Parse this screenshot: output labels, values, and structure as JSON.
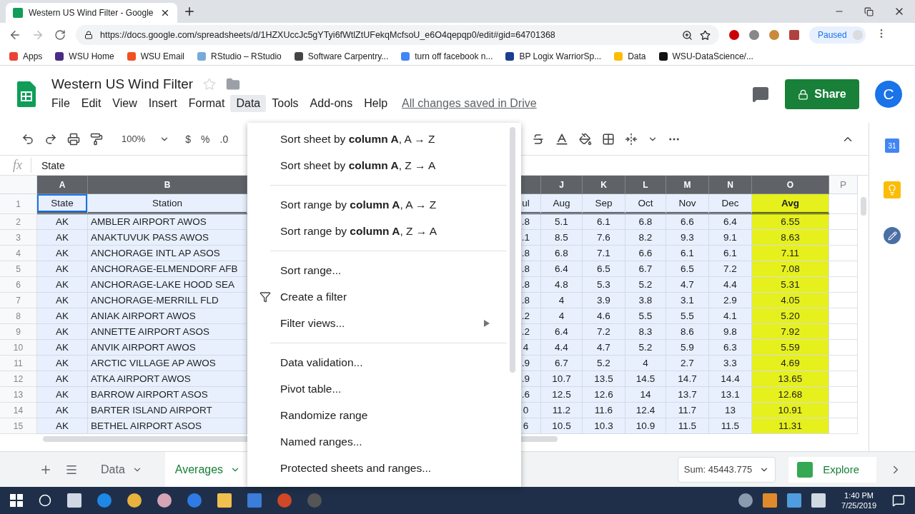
{
  "browser": {
    "tab_title": "Western US Wind Filter - Google",
    "url": "https://docs.google.com/spreadsheets/d/1HZXUccJc5gYTyi6fWtlZtUFekqMcfsoU_e6O4qepqp0/edit#gid=64701368",
    "profile_status": "Paused",
    "bookmarks": [
      {
        "label": "Apps",
        "color": "#ea4335"
      },
      {
        "label": "WSU Home",
        "color": "#4b2c83"
      },
      {
        "label": "WSU Email",
        "color": "#f25022"
      },
      {
        "label": "RStudio – RStudio",
        "color": "#75aadb"
      },
      {
        "label": "Software Carpentry...",
        "color": "#444444"
      },
      {
        "label": "turn off facebook n...",
        "color": "#4285f4"
      },
      {
        "label": "BP Logix WarriorSp...",
        "color": "#1a3d8f"
      },
      {
        "label": "Data",
        "color": "#fbbc04"
      },
      {
        "label": "WSU-DataScience/...",
        "color": "#111111"
      }
    ]
  },
  "doc": {
    "title": "Western US Wind Filter",
    "menus": [
      {
        "label": "File",
        "selected": false
      },
      {
        "label": "Edit",
        "selected": false
      },
      {
        "label": "View",
        "selected": false
      },
      {
        "label": "Insert",
        "selected": false
      },
      {
        "label": "Format",
        "selected": false
      },
      {
        "label": "Data",
        "selected": true
      },
      {
        "label": "Tools",
        "selected": false
      },
      {
        "label": "Add-ons",
        "selected": false
      },
      {
        "label": "Help",
        "selected": false
      }
    ],
    "save_status": "All changes saved in Drive",
    "share_label": "Share",
    "avatar_letter": "C"
  },
  "toolbar": {
    "zoom": "100%",
    "format_buttons": [
      "$",
      "%",
      ".0"
    ]
  },
  "formula_bar": {
    "fx_label": "fx",
    "value": "State"
  },
  "grid": {
    "header_row_number": "1",
    "columns": [
      {
        "letter": "A",
        "header": "State",
        "bold": false,
        "selected": true,
        "color": "#e8f0fe"
      },
      {
        "letter": "B",
        "header": "Station",
        "bold": false,
        "selected": false,
        "color": "#e8f0fe"
      },
      {
        "header": "ul",
        "bold": false,
        "selected": false,
        "color": "#e8f0fe"
      },
      {
        "letter": "J",
        "header": "Aug",
        "bold": false,
        "selected": false,
        "color": "#e8f0fe"
      },
      {
        "letter": "K",
        "header": "Sep",
        "bold": false,
        "selected": false,
        "color": "#e8f0fe"
      },
      {
        "letter": "L",
        "header": "Oct",
        "bold": false,
        "selected": false,
        "color": "#e8f0fe"
      },
      {
        "letter": "M",
        "header": "Nov",
        "bold": false,
        "selected": false,
        "color": "#e8f0fe"
      },
      {
        "letter": "N",
        "header": "Dec",
        "bold": false,
        "selected": false,
        "color": "#e8f0fe"
      },
      {
        "letter": "O",
        "header": "Avg",
        "bold": true,
        "selected": false,
        "color": "#e6f01c"
      }
    ],
    "extra_column": "P",
    "rows": [
      {
        "number": "2",
        "cells": [
          "AK",
          "AMBLER AIRPORT AWOS",
          ".8",
          "5.1",
          "6.1",
          "6.8",
          "6.6",
          "6.4",
          "6.55"
        ]
      },
      {
        "number": "3",
        "cells": [
          "AK",
          "ANAKTUVUK PASS AWOS",
          ".1",
          "8.5",
          "7.6",
          "8.2",
          "9.3",
          "9.1",
          "8.63"
        ]
      },
      {
        "number": "4",
        "cells": [
          "AK",
          "ANCHORAGE INTL AP ASOS",
          ".8",
          "6.8",
          "7.1",
          "6.6",
          "6.1",
          "6.1",
          "7.11"
        ]
      },
      {
        "number": "5",
        "cells": [
          "AK",
          "ANCHORAGE-ELMENDORF AFB",
          ".8",
          "6.4",
          "6.5",
          "6.7",
          "6.5",
          "7.2",
          "7.08"
        ]
      },
      {
        "number": "6",
        "cells": [
          "AK",
          "ANCHORAGE-LAKE HOOD SEA",
          ".8",
          "4.8",
          "5.3",
          "5.2",
          "4.7",
          "4.4",
          "5.31"
        ]
      },
      {
        "number": "7",
        "cells": [
          "AK",
          "ANCHORAGE-MERRILL FLD",
          ".8",
          "4",
          "3.9",
          "3.8",
          "3.1",
          "2.9",
          "4.05"
        ]
      },
      {
        "number": "8",
        "cells": [
          "AK",
          "ANIAK AIRPORT AWOS",
          ".2",
          "4",
          "4.6",
          "5.5",
          "5.5",
          "4.1",
          "5.20"
        ]
      },
      {
        "number": "9",
        "cells": [
          "AK",
          "ANNETTE AIRPORT ASOS",
          ".2",
          "6.4",
          "7.2",
          "8.3",
          "8.6",
          "9.8",
          "7.92"
        ]
      },
      {
        "number": "10",
        "cells": [
          "AK",
          "ANVIK AIRPORT AWOS",
          "4",
          "4.4",
          "4.7",
          "5.2",
          "5.9",
          "6.3",
          "5.59"
        ]
      },
      {
        "number": "11",
        "cells": [
          "AK",
          "ARCTIC VILLAGE AP AWOS",
          ".9",
          "6.7",
          "5.2",
          "4",
          "2.7",
          "3.3",
          "4.69"
        ]
      },
      {
        "number": "12",
        "cells": [
          "AK",
          "ATKA AIRPORT AWOS",
          ".9",
          "10.7",
          "13.5",
          "14.5",
          "14.7",
          "14.4",
          "13.65"
        ]
      },
      {
        "number": "13",
        "cells": [
          "AK",
          "BARROW AIRPORT ASOS",
          ".6",
          "12.5",
          "12.6",
          "14",
          "13.7",
          "13.1",
          "12.68"
        ]
      },
      {
        "number": "14",
        "cells": [
          "AK",
          "BARTER ISLAND AIRPORT",
          "0",
          "11.2",
          "11.6",
          "12.4",
          "11.7",
          "13",
          "10.91"
        ]
      },
      {
        "number": "15",
        "cells": [
          "AK",
          "BETHEL AIRPORT ASOS",
          "6",
          "10.5",
          "10.3",
          "10.9",
          "11.5",
          "11.5",
          "11.31"
        ]
      }
    ]
  },
  "side_panel": {
    "calendar_label": "31"
  },
  "data_menu": {
    "items": [
      {
        "kind": "item",
        "label": "Sort sheet by **column A**, A → Z"
      },
      {
        "kind": "item",
        "label": "Sort sheet by **column A**, Z → A"
      },
      {
        "kind": "separator"
      },
      {
        "kind": "item",
        "label": "Sort range by **column A**, A → Z"
      },
      {
        "kind": "item",
        "label": "Sort range by **column A**, Z → A"
      },
      {
        "kind": "separator"
      },
      {
        "kind": "item",
        "label": "Sort range..."
      },
      {
        "kind": "filter",
        "label": "Create a filter"
      },
      {
        "kind": "submenu",
        "label": "Filter views..."
      },
      {
        "kind": "separator"
      },
      {
        "kind": "item",
        "label": "Data validation..."
      },
      {
        "kind": "item",
        "label": "Pivot table..."
      },
      {
        "kind": "item",
        "label": "Randomize range"
      },
      {
        "kind": "item",
        "label": "Named ranges..."
      },
      {
        "kind": "item",
        "label": "Protected sheets and ranges..."
      }
    ]
  },
  "sheet_bar": {
    "tabs": [
      {
        "label": "Data",
        "selected": false
      },
      {
        "label": "Averages",
        "selected": true
      }
    ],
    "sum": "Sum: 45443.775",
    "explore_label": "Explore"
  },
  "taskbar": {
    "time": "1:40 PM",
    "date": "7/25/2019"
  }
}
